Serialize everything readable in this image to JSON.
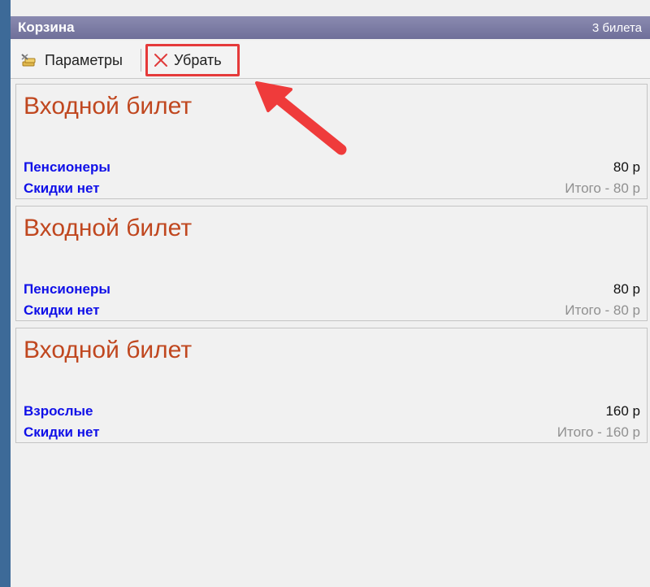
{
  "window": {
    "title": "Корзина",
    "count": "3 билета"
  },
  "toolbar": {
    "params_label": "Параметры",
    "remove_label": "Убрать"
  },
  "colors": {
    "accent_highlight": "#e53a3a",
    "title_text": "#c0471f",
    "link_text": "#1010e8"
  },
  "tickets": [
    {
      "title": "Входной билет",
      "category": "Пенсионеры",
      "discount": "Скидки нет",
      "price": "80 р",
      "total": "Итого - 80 р"
    },
    {
      "title": "Входной билет",
      "category": "Пенсионеры",
      "discount": "Скидки нет",
      "price": "80 р",
      "total": "Итого - 80 р"
    },
    {
      "title": "Входной билет",
      "category": "Взрослые",
      "discount": "Скидки нет",
      "price": "160 р",
      "total": "Итого - 160 р"
    }
  ]
}
